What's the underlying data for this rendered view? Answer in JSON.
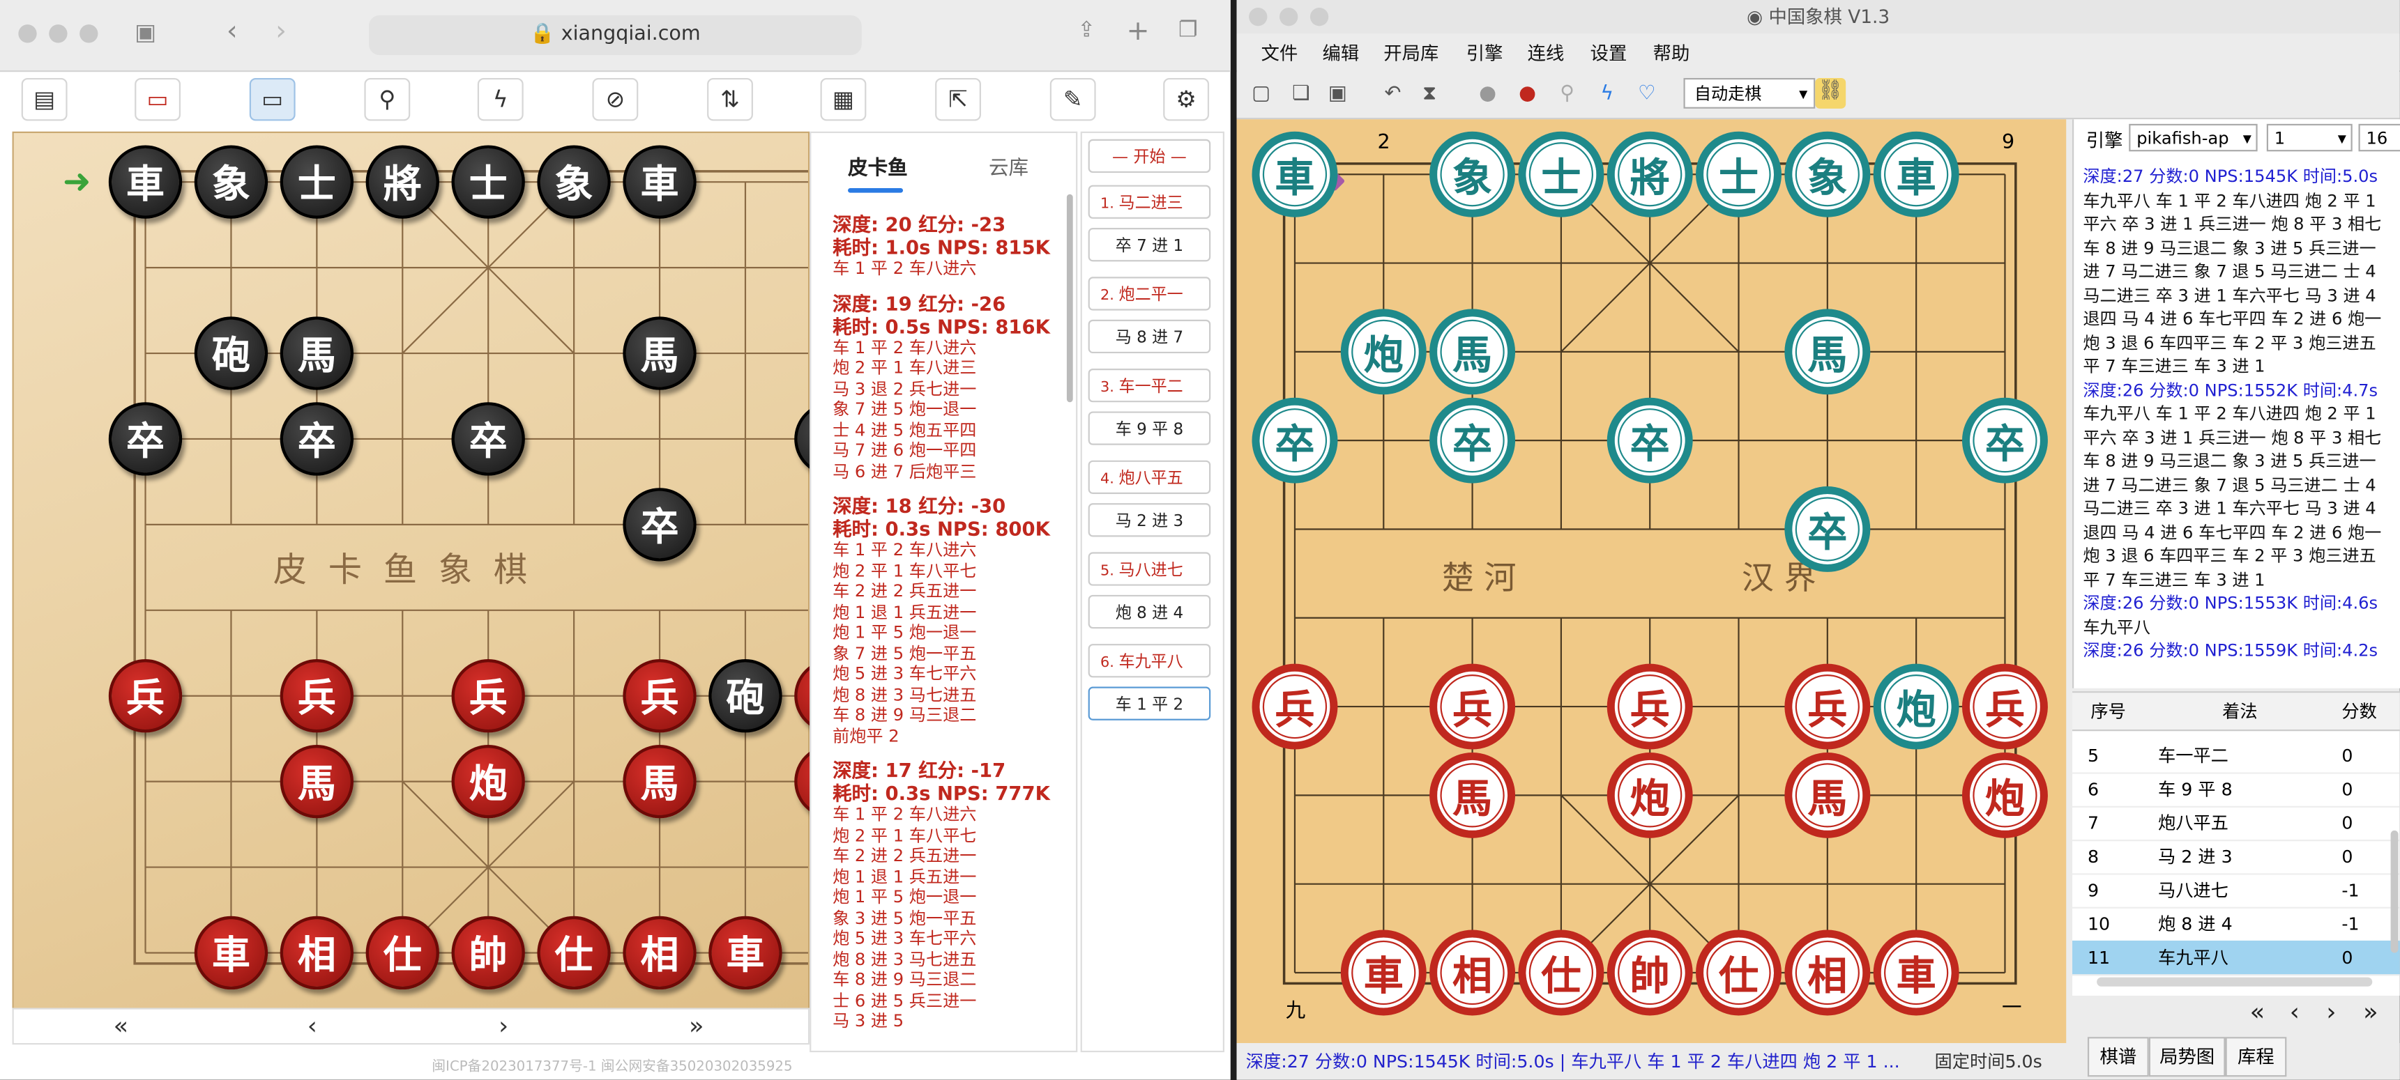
{
  "left_window": {
    "url": "xiangqiai.com",
    "board_watermark": "皮卡鱼象棋",
    "icons": [
      "new-game-icon",
      "red-computer-icon",
      "black-computer-icon",
      "search-icon",
      "flash-icon",
      "no-entry-icon",
      "flip-icon",
      "clipboard-icon",
      "share-icon",
      "edit-icon",
      "gear-icon"
    ],
    "tabs": [
      "皮卡鱼",
      "云库"
    ],
    "analysis": [
      {
        "depth": "深度: 20 红分: -23",
        "time": "耗时: 1.0s NPS: 815K",
        "lines": [
          "车 1 平 2  车八进六"
        ]
      },
      {
        "depth": "深度: 19 红分: -26",
        "time": "耗时: 0.5s NPS: 816K",
        "lines": [
          "车 1 平 2  车八进六",
          "炮 2 平 1  车八进三",
          "马 3 退 2  兵七进一",
          "象 7 进 5  炮一退一",
          "士 4 进 5  炮五平四",
          "马 7 进 6  炮一平四",
          "马 6 进 7  后炮平三"
        ]
      },
      {
        "depth": "深度: 18 红分: -30",
        "time": "耗时: 0.3s NPS: 800K",
        "lines": [
          "车 1 平 2  车八进六",
          "炮 2 平 1  车八平七",
          "车 2 进 2  兵五进一",
          "炮 1 退 1  兵五进一",
          "炮 1 平 5  炮一退一",
          "象 7 进 5  炮一平五",
          "炮 5 进 3  车七平六",
          "炮 8 进 3  马七进五",
          "车 8 进 9  马三退二",
          "前炮平 2"
        ]
      },
      {
        "depth": "深度: 17 红分: -17",
        "time": "耗时: 0.3s NPS: 777K",
        "lines": [
          "车 1 平 2  车八进六",
          "炮 2 平 1  车八平七",
          "车 2 进 2  兵五进一",
          "炮 1 退 1  兵五进一",
          "炮 1 平 5  炮一退一",
          "象 3 进 5  炮一平五",
          "炮 5 进 3  车七平六",
          "炮 8 进 3  马七进五",
          "车 8 进 9  马三退二",
          "士 6 进 5  兵三进一",
          "马 3 进 5"
        ]
      }
    ],
    "moves": [
      {
        "label": "— 开始 —"
      },
      {
        "num": "1.",
        "red": "马二进三",
        "black": "卒 7 进 1"
      },
      {
        "num": "2.",
        "red": "炮二平一",
        "black": "马 8 进 7"
      },
      {
        "num": "3.",
        "red": "车一平二",
        "black": "车 9 平 8"
      },
      {
        "num": "4.",
        "red": "炮八平五",
        "black": "马 2 进 3"
      },
      {
        "num": "5.",
        "red": "马八进七",
        "black": "炮 8 进 4"
      },
      {
        "num": "6.",
        "red": "车九平八",
        "black": "车 1 平 2"
      }
    ],
    "nav": [
      "«",
      "‹",
      "›",
      "»"
    ],
    "beian": "闽ICP备2023017377号-1    闽公网安备35020302035925",
    "board_pieces_black": [
      [
        "車",
        0,
        0
      ],
      [
        "象",
        1,
        0
      ],
      [
        "士",
        2,
        0
      ],
      [
        "將",
        3,
        0
      ],
      [
        "士",
        4,
        0
      ],
      [
        "象",
        5,
        0
      ],
      [
        "車",
        6,
        0
      ],
      [
        "砲",
        1,
        2
      ],
      [
        "馬",
        2,
        2
      ],
      [
        "馬",
        6,
        2
      ],
      [
        "卒",
        0,
        3
      ],
      [
        "卒",
        2,
        3
      ],
      [
        "卒",
        4,
        3
      ],
      [
        "卒",
        8,
        3
      ],
      [
        "卒",
        6,
        4
      ],
      [
        "砲",
        7,
        6
      ]
    ],
    "board_pieces_red": [
      [
        "兵",
        0,
        6
      ],
      [
        "兵",
        2,
        6
      ],
      [
        "兵",
        4,
        6
      ],
      [
        "兵",
        6,
        6
      ],
      [
        "兵",
        8,
        6
      ],
      [
        "馬",
        2,
        7
      ],
      [
        "炮",
        4,
        7
      ],
      [
        "馬",
        6,
        7
      ],
      [
        "炮",
        8,
        7
      ],
      [
        "車",
        1,
        9
      ],
      [
        "相",
        2,
        9
      ],
      [
        "仕",
        3,
        9
      ],
      [
        "帥",
        4,
        9
      ],
      [
        "仕",
        5,
        9
      ],
      [
        "相",
        6,
        9
      ],
      [
        "車",
        7,
        9
      ]
    ]
  },
  "right_window": {
    "title": "中国象棋 V1.3",
    "menu": [
      "文件",
      "编辑",
      "开局库",
      "引擎",
      "连线",
      "设置",
      "帮助"
    ],
    "auto_mode": "自动走棋",
    "engine_label": "引擎",
    "engine_name": "pikafish-ap",
    "engine_threads": "1",
    "engine_hash": "16",
    "river_left": "楚    河",
    "river_right": "汉    界",
    "file_top_left": "2",
    "file_top_right": "9",
    "file_bottom_left": "九",
    "file_bottom_right": "一",
    "engine_output": [
      {
        "style": "blue",
        "text": "深度:27 分数:0  NPS:1545K 时间:5.0s"
      },
      {
        "style": "",
        "text": "车九平八  车 1 平 2  车八进四  炮 2 平 1"
      },
      {
        "style": "",
        "text": "平六  卒 3 进 1  兵三进一  炮 8 平 3  相七"
      },
      {
        "style": "",
        "text": "车 8 进 9  马三退二  象 3 进 5  兵三进一"
      },
      {
        "style": "",
        "text": "进 7  马二进三  象 7 退 5  马三进二  士 4"
      },
      {
        "style": "",
        "text": "马二进三  卒 3 进 1  车六平七  马 3 进 4"
      },
      {
        "style": "",
        "text": "退四  马 4 进 6  车七平四  车 2 进 6  炮一"
      },
      {
        "style": "",
        "text": "炮 3 退 6  车四平三  车 2 平 3  炮三进五"
      },
      {
        "style": "",
        "text": "平 7  车三进三  车 3 进 1"
      },
      {
        "style": "blue",
        "text": "深度:26 分数:0  NPS:1552K 时间:4.7s"
      },
      {
        "style": "",
        "text": "车九平八  车 1 平 2  车八进四  炮 2 平 1"
      },
      {
        "style": "",
        "text": "平六  卒 3 进 1  兵三进一  炮 8 平 3  相七"
      },
      {
        "style": "",
        "text": "车 8 进 9  马三退二  象 3 进 5  兵三进一"
      },
      {
        "style": "",
        "text": "进 7  马二进三  象 7 退 5  马三进二  士 4"
      },
      {
        "style": "",
        "text": "马二进三  卒 3 进 1  车六平七  马 3 进 4"
      },
      {
        "style": "",
        "text": "退四  马 4 进 6  车七平四  车 2 进 6  炮一"
      },
      {
        "style": "",
        "text": "炮 3 退 6  车四平三  车 2 平 3  炮三进五"
      },
      {
        "style": "",
        "text": "平 7  车三进三  车 3 进 1"
      },
      {
        "style": "blue",
        "text": "深度:26 分数:0  NPS:1553K 时间:4.6s"
      },
      {
        "style": "",
        "text": "车九平八"
      },
      {
        "style": "blue",
        "text": "深度:26 分数:0  NPS:1559K 时间:4.2s"
      }
    ],
    "table_headers": [
      "序号",
      "着法",
      "分数"
    ],
    "table_rows": [
      [
        "5",
        "车一平二",
        "0"
      ],
      [
        "6",
        "车 9 平 8",
        "0"
      ],
      [
        "7",
        "炮八平五",
        "0"
      ],
      [
        "8",
        "马 2 进 3",
        "0"
      ],
      [
        "9",
        "马八进七",
        "-1"
      ],
      [
        "10",
        "炮 8 进 4",
        "-1"
      ],
      [
        "11",
        "车九平八",
        "0"
      ]
    ],
    "nav": [
      "«",
      "‹",
      "›",
      "»"
    ],
    "bottom_tabs": [
      "棋谱",
      "局势图",
      "库程"
    ],
    "status": "深度:27 分数:0  NPS:1545K 时间:5.0s | 车九平八  车 1 平 2  车八进四  炮 2 平 1  ...",
    "status_right": "固定时间5.0s",
    "board_pieces_black": [
      [
        "車",
        0,
        0
      ],
      [
        "象",
        2,
        0
      ],
      [
        "士",
        3,
        0
      ],
      [
        "將",
        4,
        0
      ],
      [
        "士",
        5,
        0
      ],
      [
        "象",
        6,
        0
      ],
      [
        "車",
        7,
        0
      ],
      [
        "炮",
        1,
        2
      ],
      [
        "馬",
        2,
        2
      ],
      [
        "馬",
        6,
        2
      ],
      [
        "卒",
        0,
        3
      ],
      [
        "卒",
        2,
        3
      ],
      [
        "卒",
        4,
        3
      ],
      [
        "卒",
        8,
        3
      ],
      [
        "卒",
        6,
        4
      ],
      [
        "炮",
        7,
        6
      ]
    ],
    "board_pieces_red": [
      [
        "兵",
        0,
        6
      ],
      [
        "兵",
        2,
        6
      ],
      [
        "兵",
        4,
        6
      ],
      [
        "兵",
        6,
        6
      ],
      [
        "兵",
        8,
        6
      ],
      [
        "馬",
        2,
        7
      ],
      [
        "炮",
        4,
        7
      ],
      [
        "馬",
        6,
        7
      ],
      [
        "炮",
        8,
        7
      ],
      [
        "車",
        1,
        9
      ],
      [
        "相",
        2,
        9
      ],
      [
        "仕",
        3,
        9
      ],
      [
        "帥",
        4,
        9
      ],
      [
        "仕",
        5,
        9
      ],
      [
        "相",
        6,
        9
      ],
      [
        "車",
        7,
        9
      ]
    ]
  },
  "colors": {
    "teal": "#1f8a8b",
    "red": "#c0281e",
    "board": "#f0c987",
    "highlight": "#9fd3f0"
  }
}
